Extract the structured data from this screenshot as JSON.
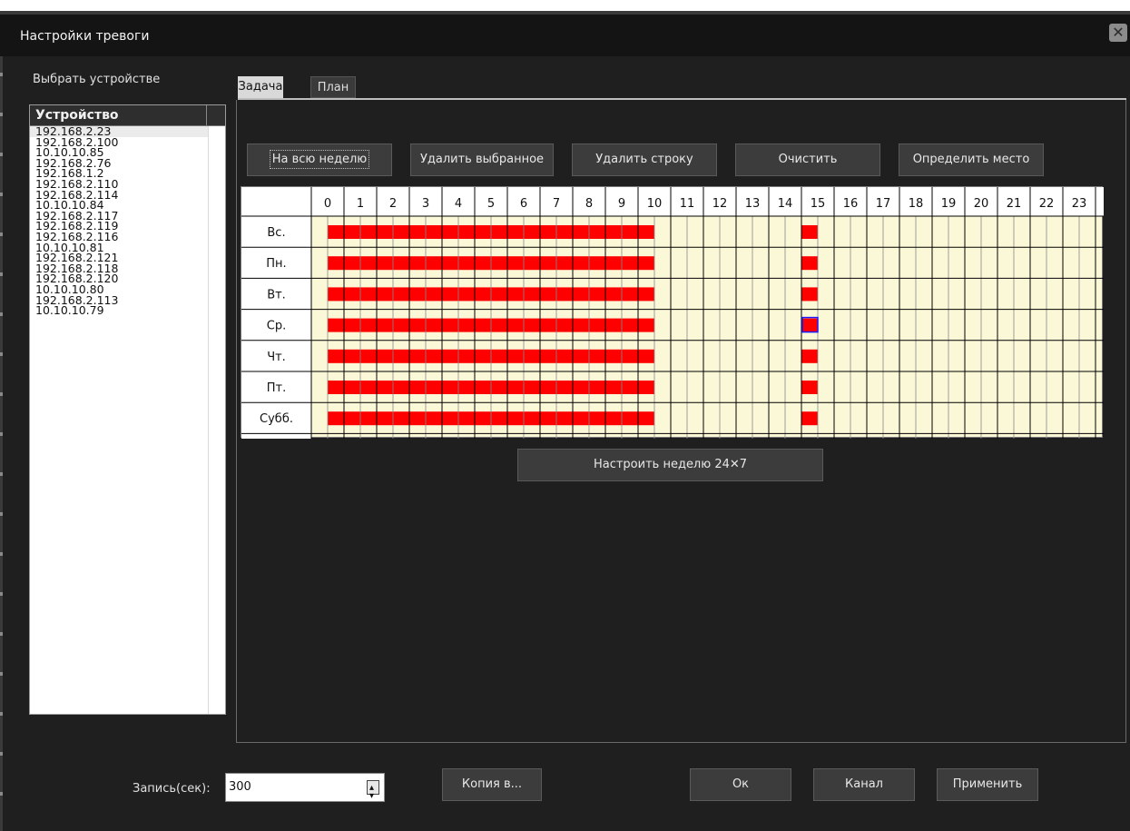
{
  "window": {
    "title": "Настройки тревоги"
  },
  "device_panel": {
    "select_label": "Выбрать устройстве",
    "column_header": "Устройство",
    "devices": [
      "192.168.2.23",
      "192.168.2.100",
      "10.10.10.85",
      "192.168.2.76",
      "192.168.1.2",
      "192.168.2.110",
      "192.168.2.114",
      "10.10.10.84",
      "192.168.2.117",
      "192.168.2.119",
      "192.168.2.116",
      "10.10.10.81",
      "192.168.2.121",
      "192.168.2.118",
      "192.168.2.120",
      "10.10.10.80",
      "192.168.2.113",
      "10.10.10.79"
    ],
    "selected_index": 0
  },
  "tabs": [
    {
      "label": "Задача",
      "active": true
    },
    {
      "label": "План",
      "active": false
    }
  ],
  "toolbar": {
    "whole_week": "На всю неделю",
    "delete_selected": "Удалить выбранное",
    "delete_row": "Удалить строку",
    "clear": "Очистить",
    "locate": "Определить место"
  },
  "schedule": {
    "hours": [
      "0",
      "1",
      "2",
      "3",
      "4",
      "5",
      "6",
      "7",
      "8",
      "9",
      "10",
      "11",
      "12",
      "13",
      "14",
      "15",
      "16",
      "17",
      "18",
      "19",
      "20",
      "21",
      "22",
      "23"
    ],
    "days": [
      "Вс.",
      "Пн.",
      "Вт.",
      "Ср.",
      "Чт.",
      "Пт.",
      "Субб."
    ],
    "active_range_start_hour": 0,
    "active_range_end_hour": 10,
    "active_extra_hour": 15,
    "focused_cell": {
      "day": "Ср.",
      "hour": 15
    },
    "colors": {
      "active": "#ff0000",
      "background": "#fbf8d8",
      "grid": "#000000",
      "focus": "#1a1aff"
    }
  },
  "configure_week_button": "Настроить неделю 24✕7",
  "bottom": {
    "record_label": "Запись(сек):",
    "record_value": "300",
    "copy_button": "Копия в...",
    "ok_button": "Ок",
    "channel_button": "Канал",
    "apply_button": "Применить"
  }
}
